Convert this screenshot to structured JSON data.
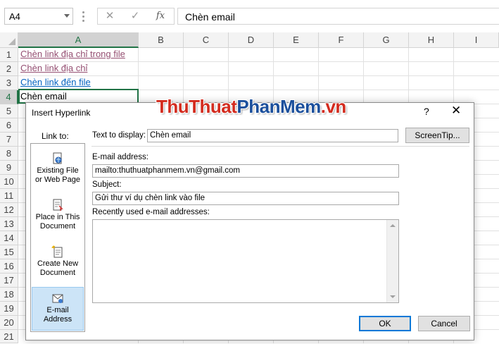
{
  "formula_bar": {
    "name_box": "A4",
    "cancel_icon": "✕",
    "enter_icon": "✓",
    "fx_label": "fx",
    "content": "Chèn email"
  },
  "columns": [
    "A",
    "B",
    "C",
    "D",
    "E",
    "F",
    "G",
    "H",
    "I"
  ],
  "rows": [
    "1",
    "2",
    "3",
    "4",
    "5",
    "6",
    "7",
    "8",
    "9",
    "10",
    "11",
    "12",
    "13",
    "14",
    "15",
    "16",
    "17",
    "18",
    "19",
    "20",
    "21"
  ],
  "cells": {
    "a1": "Chèn link địa chỉ trong file",
    "a2": "Chèn link địa chỉ",
    "a3": "Chèn link đến file",
    "a4": "Chèn email"
  },
  "watermark": {
    "part1": "ThuThuat",
    "part2": "PhanMem",
    "part3": ".vn"
  },
  "dialog": {
    "title": "Insert Hyperlink",
    "help": "?",
    "close": "✕",
    "link_to_label": "Link to:",
    "link_to_items": [
      {
        "l1": "Existing File",
        "l2": "or Web Page"
      },
      {
        "l1": "Place in This",
        "l2": "Document"
      },
      {
        "l1": "Create New",
        "l2": "Document"
      },
      {
        "l1": "E-mail",
        "l2": "Address"
      }
    ],
    "text_to_display_label": "Text to display:",
    "text_to_display_value": "Chèn email",
    "screentip_button": "ScreenTip...",
    "email_address_label": "E-mail address:",
    "email_address_value": "mailto:thuthuatphanmem.vn@gmail.com",
    "subject_label": "Subject:",
    "subject_value": "Gửi thư ví dụ chèn link vào file",
    "recent_label": "Recently used e-mail addresses:",
    "ok_button": "OK",
    "cancel_button": "Cancel"
  }
}
